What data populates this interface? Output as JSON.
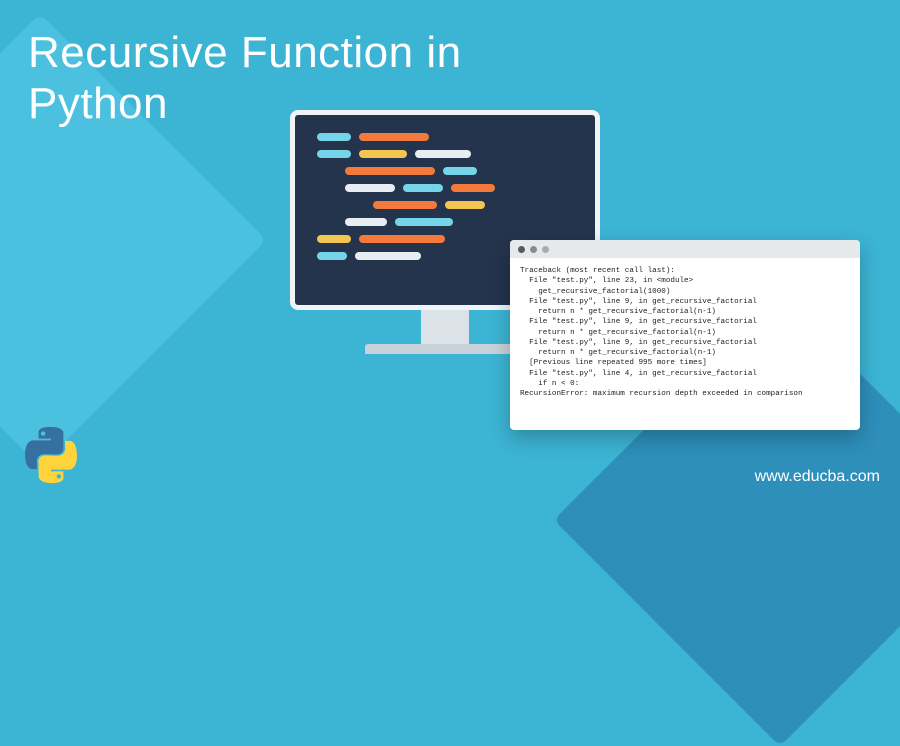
{
  "title": "Recursive Function in\nPython",
  "url": "www.educba.com",
  "terminal": {
    "lines": [
      "Traceback (most recent call last):",
      "  File \"test.py\", line 23, in <module>",
      "    get_recursive_factorial(1000)",
      "  File \"test.py\", line 9, in get_recursive_factorial",
      "    return n * get_recursive_factorial(n-1)",
      "  File \"test.py\", line 9, in get_recursive_factorial",
      "    return n * get_recursive_factorial(n-1)",
      "  File \"test.py\", line 9, in get_recursive_factorial",
      "    return n * get_recursive_factorial(n-1)",
      "  [Previous line repeated 995 more times]",
      "  File \"test.py\", line 4, in get_recursive_factorial",
      "    if n < 0:",
      "RecursionError: maximum recursion depth exceeded in comparison"
    ]
  },
  "logo_name": "python-logo"
}
